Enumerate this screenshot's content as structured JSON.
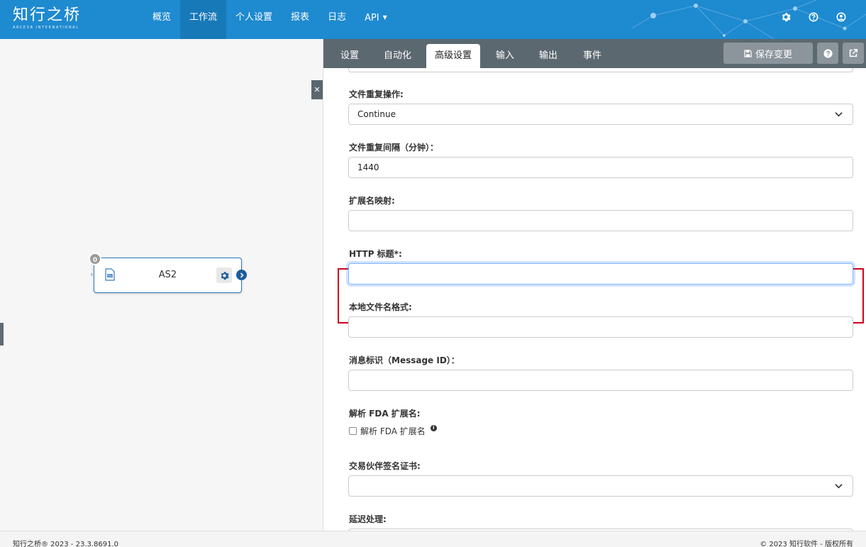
{
  "brand": {
    "name_cn": "知行之桥",
    "name_en": "ARCESB INTERNATIONAL"
  },
  "nav": {
    "items": [
      {
        "label": "概览"
      },
      {
        "label": "工作流",
        "active": true
      },
      {
        "label": "个人设置"
      },
      {
        "label": "报表"
      },
      {
        "label": "日志"
      },
      {
        "label": "API"
      }
    ]
  },
  "top_icons": [
    "gear-icon",
    "help-icon",
    "user-icon"
  ],
  "canvas": {
    "node": {
      "label": "AS2",
      "badge": "0",
      "icon": "as2-document-icon"
    }
  },
  "panel": {
    "tabs": [
      {
        "label": "设置"
      },
      {
        "label": "自动化"
      },
      {
        "label": "高级设置",
        "active": true
      },
      {
        "label": "输入"
      },
      {
        "label": "输出"
      },
      {
        "label": "事件"
      }
    ],
    "save_label": "保存变更"
  },
  "form": {
    "duplicate_action": {
      "label": "文件重复操作:",
      "value": "Continue"
    },
    "duplicate_interval": {
      "label": "文件重复间隔（分钟）：",
      "value": "1440"
    },
    "extension_map": {
      "label": "扩展名映射:",
      "value": ""
    },
    "http_headers": {
      "label": "HTTP 标题*:",
      "value": ""
    },
    "local_filename_format": {
      "label": "本地文件名格式:",
      "value": ""
    },
    "message_id": {
      "label": "消息标识（Message ID）：",
      "value": ""
    },
    "parse_fda": {
      "label": "解析 FDA 扩展名:",
      "checkbox_label": "解析 FDA 扩展名",
      "checked": false
    },
    "partner_cert": {
      "label": "交易伙伴签名证书:",
      "value": ""
    },
    "delay": {
      "label": "延迟处理:"
    }
  },
  "footer": {
    "left": "知行之桥® 2023 - 23.3.8691.0",
    "right": "© 2023 知行软件 - 版权所有"
  },
  "colors": {
    "topbar": "#1e8ad0",
    "tabbar": "#5c6870",
    "highlight": "#d0021b",
    "node_border": "#2b7bc0"
  }
}
